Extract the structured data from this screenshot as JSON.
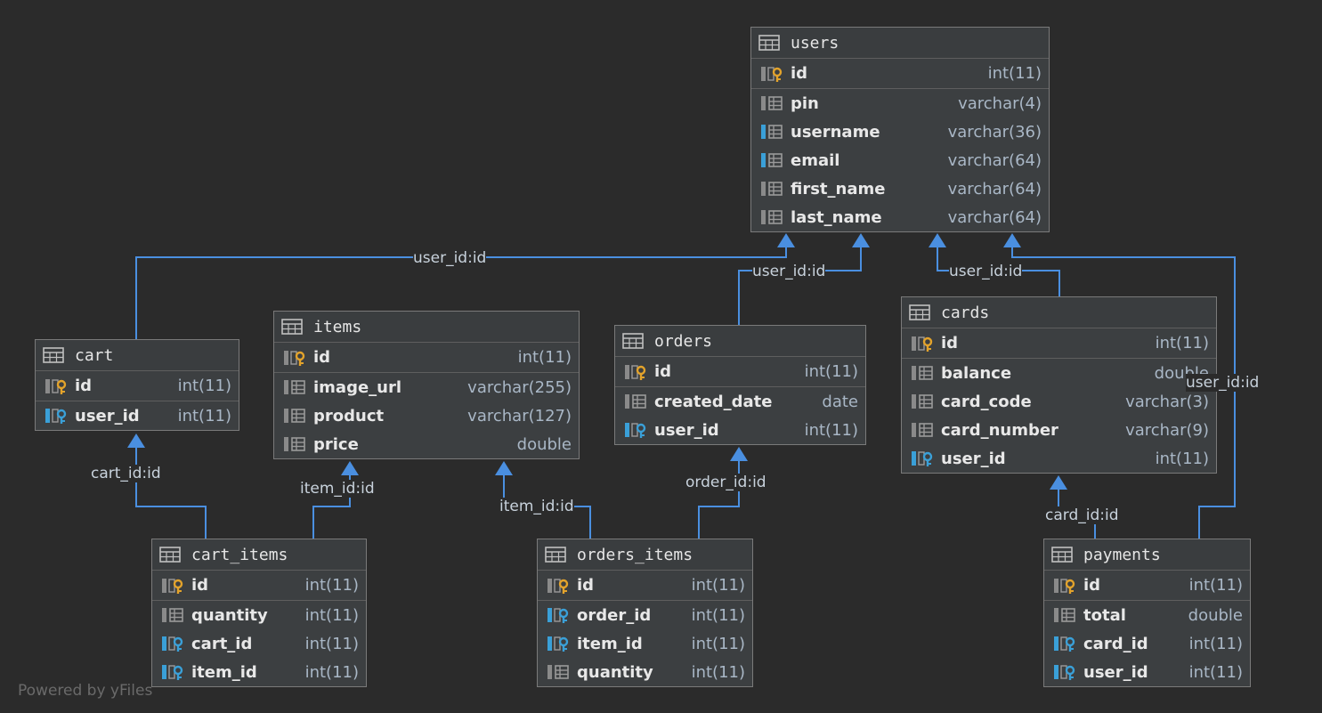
{
  "footer": "Powered by yFiles",
  "colors": {
    "edge": "#4a8fe0",
    "pk_key": "#e3a32b",
    "fk_key": "#3aa0d8",
    "col_marker": "#8a8a8a"
  },
  "tables": {
    "users": {
      "name": "users",
      "columns": [
        {
          "name": "id",
          "type": "int(11)",
          "icon": "pk-icon"
        },
        {
          "name": "pin",
          "type": "varchar(4)",
          "icon": "column-icon"
        },
        {
          "name": "username",
          "type": "varchar(36)",
          "icon": "unique-column-icon"
        },
        {
          "name": "email",
          "type": "varchar(64)",
          "icon": "unique-column-icon"
        },
        {
          "name": "first_name",
          "type": "varchar(64)",
          "icon": "column-icon"
        },
        {
          "name": "last_name",
          "type": "varchar(64)",
          "icon": "column-icon"
        }
      ]
    },
    "cart": {
      "name": "cart",
      "columns": [
        {
          "name": "id",
          "type": "int(11)",
          "icon": "pk-icon"
        },
        {
          "name": "user_id",
          "type": "int(11)",
          "icon": "fk-icon"
        }
      ]
    },
    "items": {
      "name": "items",
      "columns": [
        {
          "name": "id",
          "type": "int(11)",
          "icon": "pk-icon"
        },
        {
          "name": "image_url",
          "type": "varchar(255)",
          "icon": "column-icon"
        },
        {
          "name": "product",
          "type": "varchar(127)",
          "icon": "column-icon"
        },
        {
          "name": "price",
          "type": "double",
          "icon": "column-icon"
        }
      ]
    },
    "orders": {
      "name": "orders",
      "columns": [
        {
          "name": "id",
          "type": "int(11)",
          "icon": "pk-icon"
        },
        {
          "name": "created_date",
          "type": "date",
          "icon": "column-icon"
        },
        {
          "name": "user_id",
          "type": "int(11)",
          "icon": "fk-icon"
        }
      ]
    },
    "cards": {
      "name": "cards",
      "columns": [
        {
          "name": "id",
          "type": "int(11)",
          "icon": "pk-icon"
        },
        {
          "name": "balance",
          "type": "double",
          "icon": "column-icon"
        },
        {
          "name": "card_code",
          "type": "varchar(3)",
          "icon": "column-icon"
        },
        {
          "name": "card_number",
          "type": "varchar(9)",
          "icon": "column-icon"
        },
        {
          "name": "user_id",
          "type": "int(11)",
          "icon": "fk-icon"
        }
      ]
    },
    "cart_items": {
      "name": "cart_items",
      "columns": [
        {
          "name": "id",
          "type": "int(11)",
          "icon": "pk-icon"
        },
        {
          "name": "quantity",
          "type": "int(11)",
          "icon": "column-icon"
        },
        {
          "name": "cart_id",
          "type": "int(11)",
          "icon": "fk-icon"
        },
        {
          "name": "item_id",
          "type": "int(11)",
          "icon": "fk-icon"
        }
      ]
    },
    "orders_items": {
      "name": "orders_items",
      "columns": [
        {
          "name": "id",
          "type": "int(11)",
          "icon": "pk-icon"
        },
        {
          "name": "order_id",
          "type": "int(11)",
          "icon": "fk-icon"
        },
        {
          "name": "item_id",
          "type": "int(11)",
          "icon": "fk-icon"
        },
        {
          "name": "quantity",
          "type": "int(11)",
          "icon": "column-icon"
        }
      ]
    },
    "payments": {
      "name": "payments",
      "columns": [
        {
          "name": "id",
          "type": "int(11)",
          "icon": "pk-icon"
        },
        {
          "name": "total",
          "type": "double",
          "icon": "column-icon"
        },
        {
          "name": "card_id",
          "type": "int(11)",
          "icon": "fk-icon"
        },
        {
          "name": "user_id",
          "type": "int(11)",
          "icon": "fk-icon"
        }
      ]
    }
  },
  "relations": {
    "cart_users": "user_id:id",
    "orders_users": "user_id:id",
    "cards_users": "user_id:id",
    "payments_users": "user_id:id",
    "cartitems_cart": "cart_id:id",
    "cartitems_items": "item_id:id",
    "ordersitems_items": "item_id:id",
    "ordersitems_orders": "order_id:id",
    "payments_cards": "card_id:id"
  }
}
